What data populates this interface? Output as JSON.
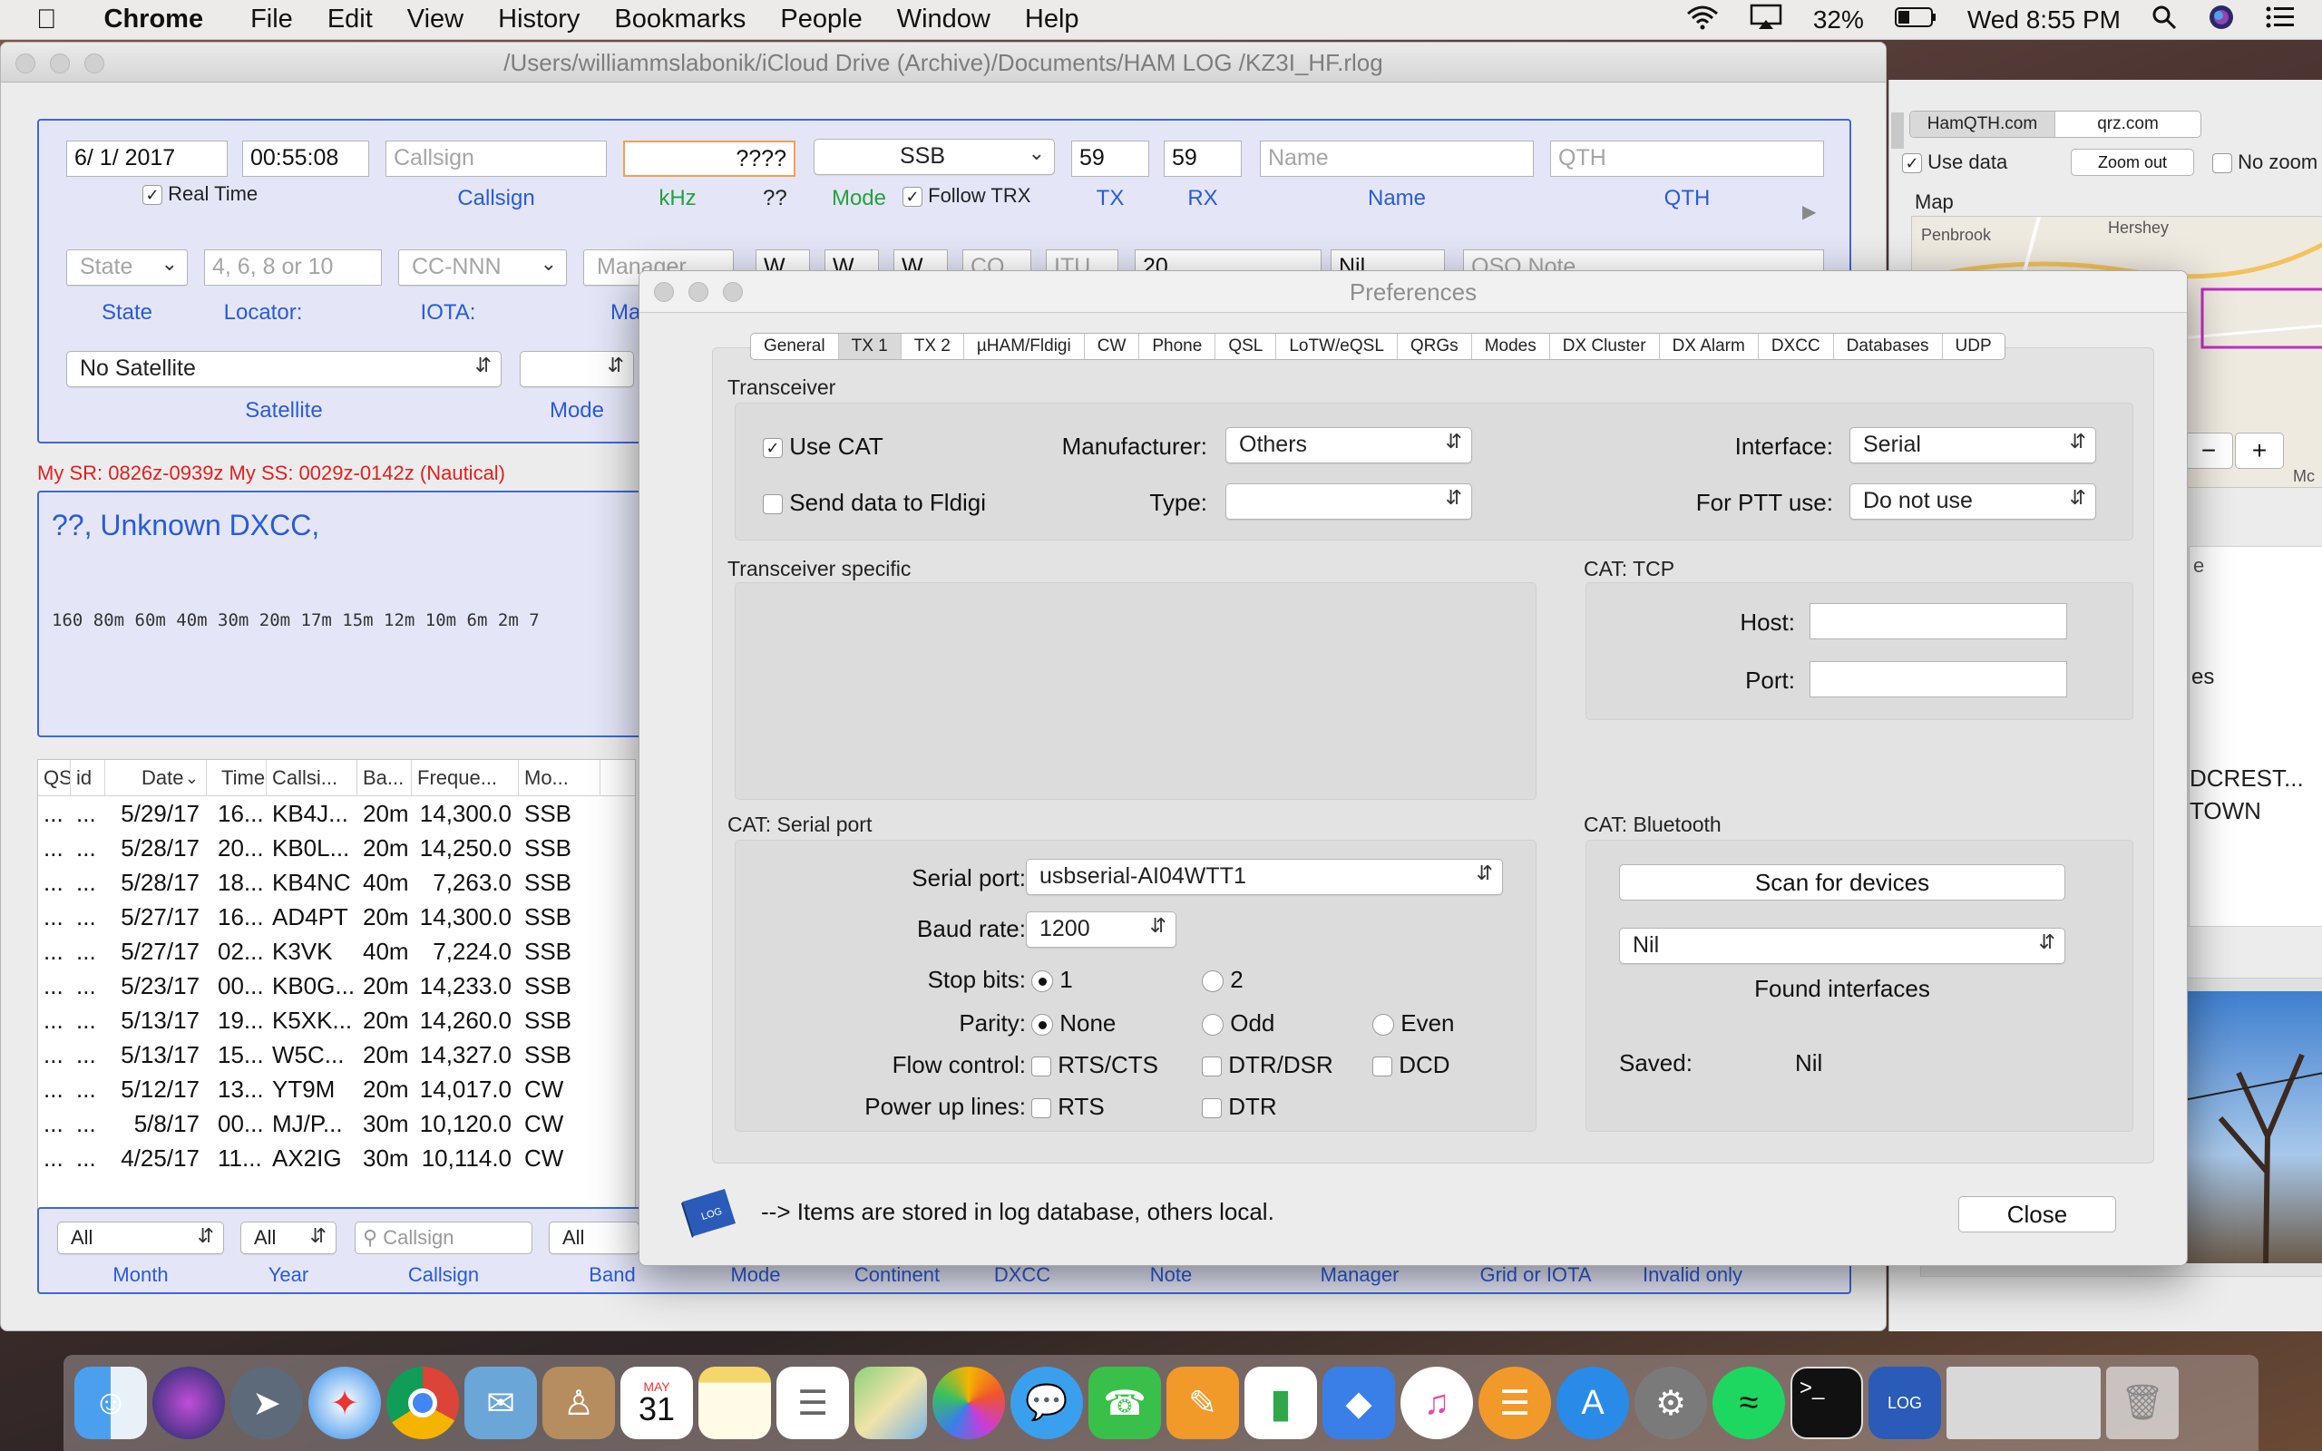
{
  "menubar": {
    "app": "Chrome",
    "items": [
      "File",
      "Edit",
      "View",
      "History",
      "Bookmarks",
      "People",
      "Window",
      "Help"
    ],
    "battery": "32%",
    "clock": "Wed 8:55 PM"
  },
  "main": {
    "title": "/Users/williammslabonik/iCloud Drive (Archive)/Documents/HAM LOG /KZ3I_HF.rlog",
    "entry": {
      "date": "6/  1/ 2017",
      "time": "00:55:08",
      "realtime_label": "Real Time",
      "callsign_ph": "Callsign",
      "khz_value": "????",
      "mode_value": "SSB",
      "tx": "59",
      "rx": "59",
      "name_ph": "Name",
      "qth_ph": "QTH",
      "lbl_callsign": "Callsign",
      "lbl_khz": "kHz",
      "lbl_qq": "??",
      "lbl_mode": "Mode",
      "lbl_follow": "Follow TRX",
      "lbl_tx": "TX",
      "lbl_rx": "RX",
      "lbl_name": "Name",
      "lbl_qth": "QTH",
      "state_ph": "State",
      "locator_ph": "4, 6, 8 or 10",
      "iota_ph": "CC-NNN",
      "manager_ph": "Manager",
      "lbl_state": "State",
      "lbl_locator": "Locator:",
      "lbl_iota": "IOTA:",
      "lbl_manager": "Mar",
      "satellite": "No Satellite",
      "lbl_satellite": "Satellite",
      "lbl_mode2": "Mode",
      "extra_w1": "W",
      "extra_w2": "W",
      "extra_w3": "W",
      "extra_cq": "CQ",
      "extra_itu": "ITU",
      "extra_20": "20",
      "extra_nil": "Nil",
      "qso_note_ph": "QSO Note"
    },
    "sun": "My SR: 0826z-0939z  My SS: 0029z-0142z (Nautical)",
    "dxcc": "??, Unknown DXCC,",
    "bands": "160  80m  60m  40m  30m  20m  17m  15m  12m  10m    6m    2m  7",
    "table": {
      "headers": [
        "QS",
        "id",
        "Date",
        "Time",
        "Callsi...",
        "Ba...",
        "Freque...",
        "Mo..."
      ],
      "rows": [
        [
          "...",
          "...",
          "5/29/17",
          "16...",
          "KB4J...",
          "20m",
          "14,300.0",
          "SSB"
        ],
        [
          "...",
          "...",
          "5/28/17",
          "20...",
          "KB0L...",
          "20m",
          "14,250.0",
          "SSB"
        ],
        [
          "...",
          "...",
          "5/28/17",
          "18...",
          "KB4NC",
          "40m",
          "7,263.0",
          "SSB"
        ],
        [
          "...",
          "...",
          "5/27/17",
          "16...",
          "AD4PT",
          "20m",
          "14,300.0",
          "SSB"
        ],
        [
          "...",
          "...",
          "5/27/17",
          "02...",
          "K3VK",
          "40m",
          "7,224.0",
          "SSB"
        ],
        [
          "...",
          "...",
          "5/23/17",
          "00...",
          "KB0G...",
          "20m",
          "14,233.0",
          "SSB"
        ],
        [
          "...",
          "...",
          "5/13/17",
          "19...",
          "K5XK...",
          "20m",
          "14,260.0",
          "SSB"
        ],
        [
          "...",
          "...",
          "5/13/17",
          "15...",
          "W5C...",
          "20m",
          "14,327.0",
          "SSB"
        ],
        [
          "...",
          "...",
          "5/12/17",
          "13...",
          "YT9M",
          "20m",
          "14,017.0",
          "CW"
        ],
        [
          "...",
          "...",
          "5/8/17",
          "00...",
          "MJ/P...",
          "30m",
          "10,120.0",
          "CW"
        ],
        [
          "...",
          "...",
          "4/25/17",
          "11...",
          "AX2IG",
          "30m",
          "10,114.0",
          "CW"
        ]
      ]
    },
    "filter": {
      "month": "All",
      "year": "All",
      "callsign_ph": "Callsign",
      "band": "All",
      "labels": [
        "Month",
        "Year",
        "Callsign",
        "Band",
        "Mode",
        "Continent",
        "DXCC",
        "Note",
        "Manager",
        "Grid or IOTA",
        "Invalid only"
      ]
    }
  },
  "rightwin": {
    "tab1": "HamQTH.com",
    "tab2": "qrz.com",
    "use_data": "Use data",
    "zoom_out": "Zoom out",
    "no_zoom": "No zoom",
    "map_label": "Map",
    "town1": "Penbrook",
    "town2": "Hershey",
    "minus": "−",
    "plus": "+",
    "mc": "Mc",
    "col_e": "e",
    "s": "es",
    "crest": "DCREST...",
    "town": "TOWN"
  },
  "prefs": {
    "title": "Preferences",
    "tabs": [
      "General",
      "TX 1",
      "TX 2",
      "µHAM/Fldigi",
      "CW",
      "Phone",
      "QSL",
      "LoTW/eQSL",
      "QRGs",
      "Modes",
      "DX Cluster",
      "DX Alarm",
      "DXCC",
      "Databases",
      "UDP"
    ],
    "transceiver": {
      "title": "Transceiver",
      "use_cat": "Use CAT",
      "send_fldigi": "Send data to Fldigi",
      "manufacturer_label": "Manufacturer:",
      "manufacturer": "Others",
      "type_label": "Type:",
      "type": "",
      "interface_label": "Interface:",
      "interface": "Serial",
      "ptt_label": "For PTT use:",
      "ptt": "Do not use"
    },
    "specific_title": "Transceiver specific",
    "tcp": {
      "title": "CAT: TCP",
      "host_label": "Host:",
      "port_label": "Port:",
      "host": "",
      "port": ""
    },
    "serial": {
      "title": "CAT: Serial port",
      "port_label": "Serial port:",
      "port": "usbserial-AI04WTT1",
      "baud_label": "Baud rate:",
      "baud": "1200",
      "stop_label": "Stop bits:",
      "stop1": "1",
      "stop2": "2",
      "parity_label": "Parity:",
      "parity_none": "None",
      "parity_odd": "Odd",
      "parity_even": "Even",
      "flow_label": "Flow control:",
      "flow1": "RTS/CTS",
      "flow2": "DTR/DSR",
      "flow3": "DCD",
      "power_label": "Power up lines:",
      "power1": "RTS",
      "power2": "DTR"
    },
    "bt": {
      "title": "CAT: Bluetooth",
      "scan": "Scan for devices",
      "device": "Nil",
      "found": "Found interfaces",
      "saved_label": "Saved:",
      "saved": "Nil"
    },
    "footer_note": "--> Items are stored in log database, others local.",
    "close": "Close",
    "log_icon_text": "LOG"
  },
  "dock": {
    "calendar_month": "MAY",
    "calendar_day": "31",
    "icons": [
      "finder-icon",
      "siri-icon",
      "launchpad-icon",
      "safari-icon",
      "chrome-icon",
      "mail-icon",
      "contacts-icon",
      "calendar-icon",
      "notes-icon",
      "reminders-icon",
      "maps-icon",
      "photos-icon",
      "messages-icon",
      "facetime-icon",
      "pages-icon",
      "numbers-icon",
      "keynote-icon",
      "itunes-icon",
      "ibooks-icon",
      "appstore-icon",
      "preferences-icon",
      "spotify-icon",
      "terminal-icon",
      "rumlog-icon",
      "window-thumb-icon",
      "trash-icon"
    ]
  }
}
